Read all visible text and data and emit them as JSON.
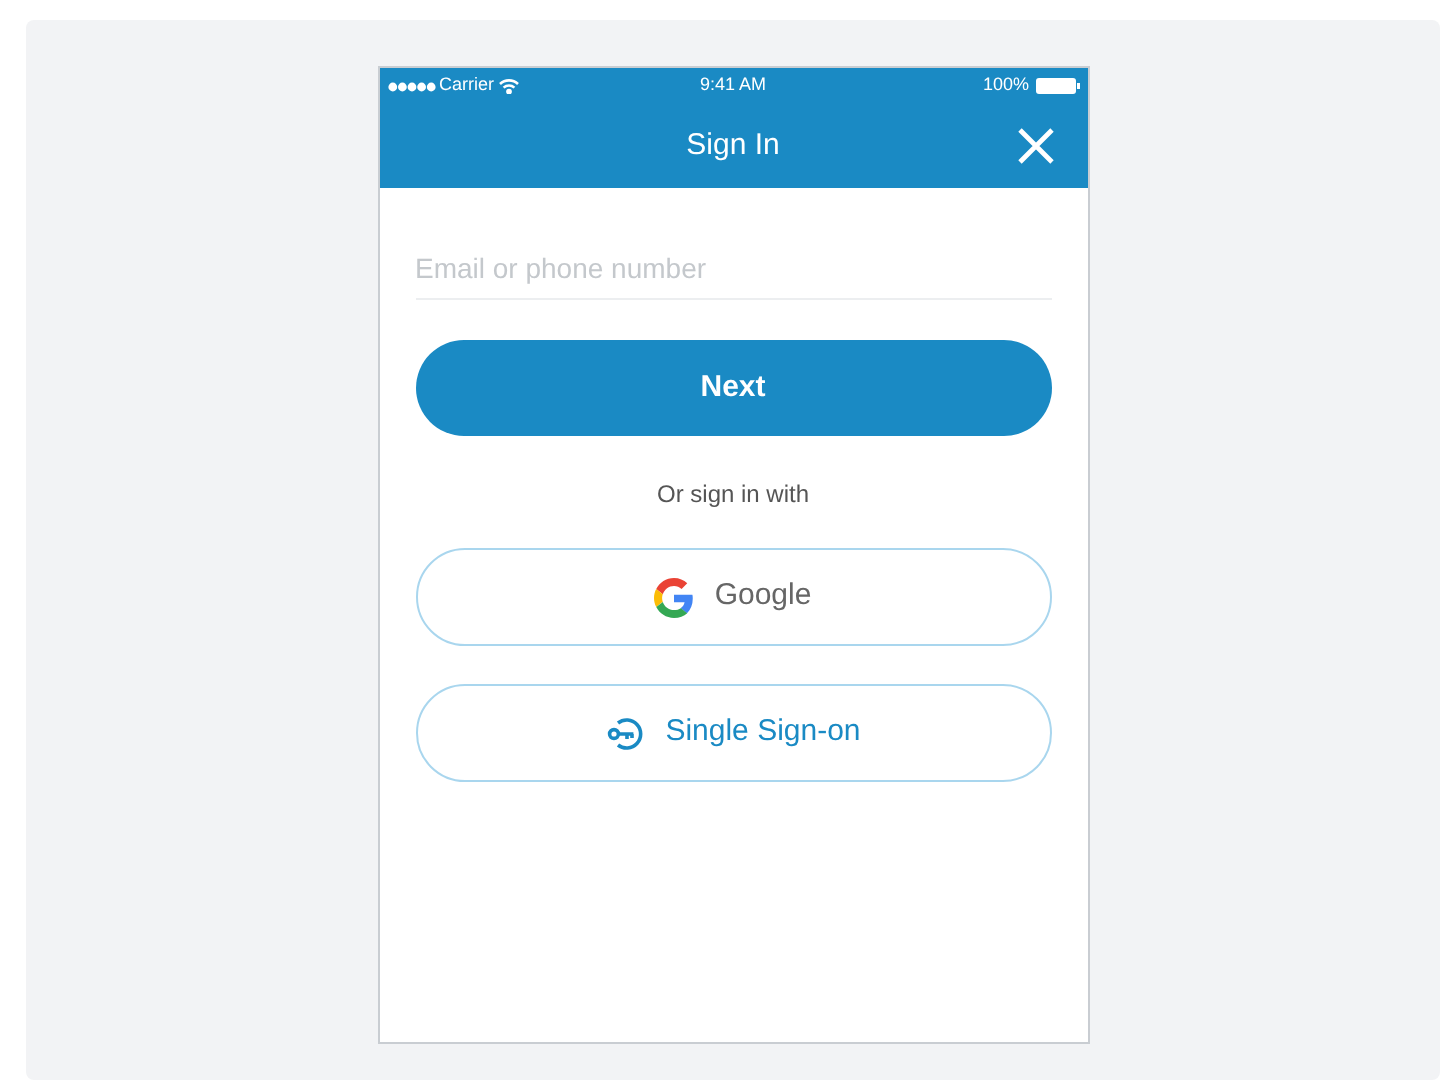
{
  "status_bar": {
    "carrier": "Carrier",
    "time": "9:41 AM",
    "battery": "100%"
  },
  "header": {
    "title": "Sign In"
  },
  "email": {
    "placeholder": "Email or phone number"
  },
  "next_button": "Next",
  "divider_text": "Or sign in with",
  "providers": [
    {
      "kind": "google",
      "label": "Google"
    },
    {
      "kind": "sso",
      "label": "Single Sign-on"
    }
  ]
}
